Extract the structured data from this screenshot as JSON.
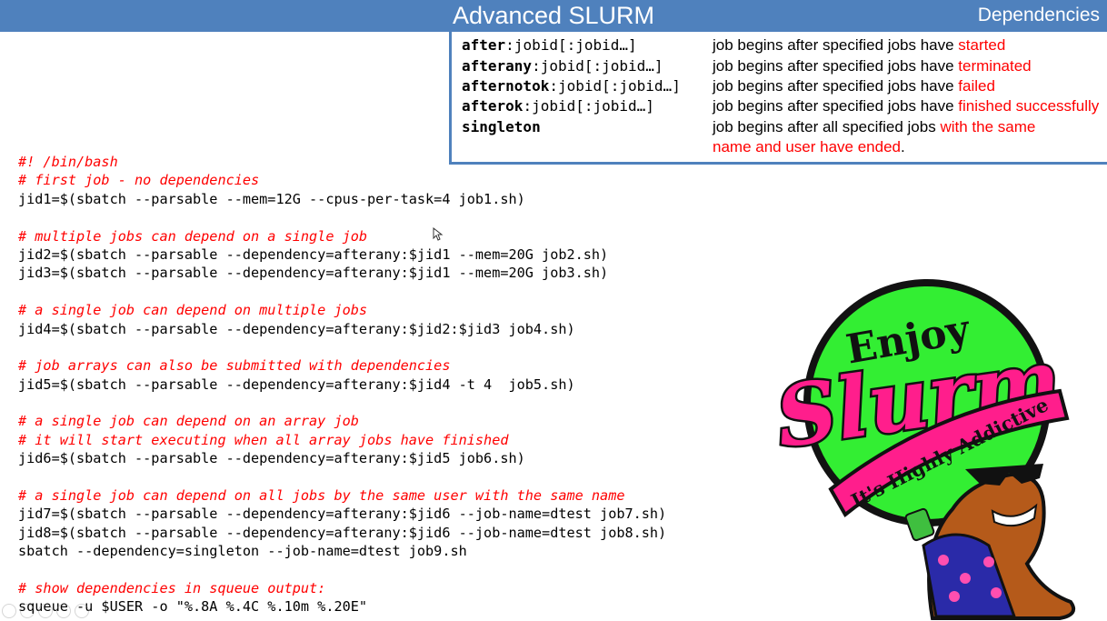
{
  "header": {
    "title": "Advanced SLURM",
    "section": "Dependencies"
  },
  "dependencies": [
    {
      "keyword": "after",
      "args": ":jobid[:jobid…]",
      "desc_black": "job begins after specified jobs have ",
      "desc_red": "started",
      "desc_red2": ""
    },
    {
      "keyword": "afterany",
      "args": ":jobid[:jobid…]",
      "desc_black": "job begins after specified jobs have ",
      "desc_red": "terminated",
      "desc_red2": ""
    },
    {
      "keyword": "afternotok",
      "args": ":jobid[:jobid…]",
      "desc_black": "job begins after specified jobs have ",
      "desc_red": "failed",
      "desc_red2": ""
    },
    {
      "keyword": "afterok",
      "args": ":jobid[:jobid…]",
      "desc_black": "job begins after specified jobs have ",
      "desc_red": "finished successfully",
      "desc_red2": ""
    },
    {
      "keyword": "singleton",
      "args": "",
      "desc_black": "job begins after all specified jobs ",
      "desc_red": "with the same",
      "desc_red2": "name and user have ended"
    }
  ],
  "code_lines": [
    {
      "text": "#! /bin/bash",
      "comment": true
    },
    {
      "text": "# first job - no dependencies",
      "comment": true
    },
    {
      "text": "jid1=$(sbatch --parsable --mem=12G --cpus-per-task=4 job1.sh)",
      "comment": false
    },
    {
      "text": "",
      "comment": false
    },
    {
      "text": "# multiple jobs can depend on a single job",
      "comment": true
    },
    {
      "text": "jid2=$(sbatch --parsable --dependency=afterany:$jid1 --mem=20G job2.sh)",
      "comment": false
    },
    {
      "text": "jid3=$(sbatch --parsable --dependency=afterany:$jid1 --mem=20G job3.sh)",
      "comment": false
    },
    {
      "text": "",
      "comment": false
    },
    {
      "text": "# a single job can depend on multiple jobs",
      "comment": true
    },
    {
      "text": "jid4=$(sbatch --parsable --dependency=afterany:$jid2:$jid3 job4.sh)",
      "comment": false
    },
    {
      "text": "",
      "comment": false
    },
    {
      "text": "# job arrays can also be submitted with dependencies",
      "comment": true
    },
    {
      "text": "jid5=$(sbatch --parsable --dependency=afterany:$jid4 -t 4  job5.sh)",
      "comment": false
    },
    {
      "text": "",
      "comment": false
    },
    {
      "text": "# a single job can depend on an array job",
      "comment": true
    },
    {
      "text": "# it will start executing when all array jobs have finished",
      "comment": true
    },
    {
      "text": "jid6=$(sbatch --parsable --dependency=afterany:$jid5 job6.sh)",
      "comment": false
    },
    {
      "text": "",
      "comment": false
    },
    {
      "text": "# a single job can depend on all jobs by the same user with the same name",
      "comment": true
    },
    {
      "text": "jid7=$(sbatch --parsable --dependency=afterany:$jid6 --job-name=dtest job7.sh)",
      "comment": false
    },
    {
      "text": "jid8=$(sbatch --parsable --dependency=afterany:$jid6 --job-name=dtest job8.sh)",
      "comment": false
    },
    {
      "text": "sbatch --dependency=singleton --job-name=dtest job9.sh",
      "comment": false
    },
    {
      "text": "",
      "comment": false
    },
    {
      "text": "# show dependencies in squeue output:",
      "comment": true
    },
    {
      "text": "squeue -u $USER -o \"%.8A %.4C %.10m %.20E\"",
      "comment": false
    }
  ],
  "logo": {
    "word1": "Enjoy",
    "word2": "Slurm",
    "tagline": "It's Highly Addictive"
  },
  "colors": {
    "header_blue": "#4f81bd",
    "comment_red": "#ff0000",
    "logo_green": "#33ee33",
    "logo_pink": "#ff1e8c",
    "slug_brown": "#b55a1a"
  }
}
